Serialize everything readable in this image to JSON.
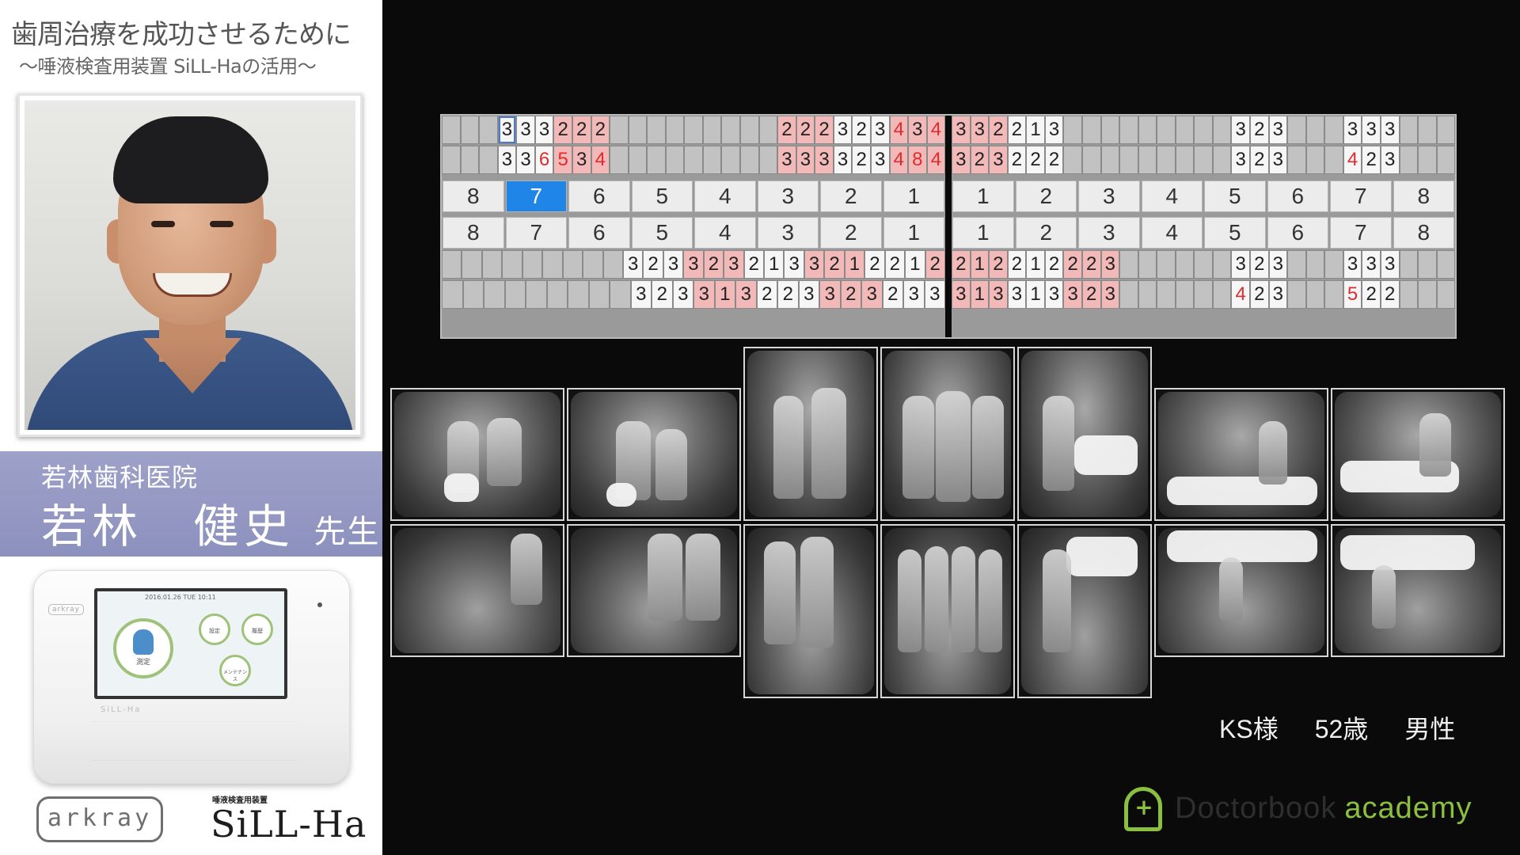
{
  "lecture": {
    "title": "歯周治療を成功させるために",
    "subtitle": "〜唾液検査用装置 SiLL-Haの活用〜"
  },
  "presenter": {
    "clinic": "若林歯科医院",
    "name": "若林　健史",
    "title": "先生"
  },
  "device": {
    "brand_mark": "arkray",
    "screen_date": "2016.01.26 TUE 10:11",
    "measure_label": "測定",
    "settings_label": "設定",
    "history_label": "履歴",
    "maintenance_label": "メンテナンス",
    "model_text": "SiLL-Ha"
  },
  "logos": {
    "arkray": "arkray",
    "sillha_caption": "唾液検査用装置",
    "sillha": "SiLL-Ha"
  },
  "perio_chart": {
    "right_jaw": {
      "upper_rows": [
        [
          "",
          "",
          "",
          "3",
          "3",
          "3",
          "2",
          "2",
          "2",
          "",
          "",
          "",
          "",
          "",
          "",
          "",
          "",
          "",
          "2",
          "2",
          "2",
          "3",
          "2",
          "3",
          "4",
          "3",
          "4"
        ],
        [
          "",
          "",
          "",
          "3",
          "3",
          "6",
          "5",
          "3",
          "4",
          "",
          "",
          "",
          "",
          "",
          "",
          "",
          "",
          "",
          "3",
          "3",
          "3",
          "3",
          "2",
          "3",
          "4",
          "8",
          "4"
        ]
      ],
      "teeth_upper": [
        "8",
        "7",
        "6",
        "5",
        "4",
        "3",
        "2",
        "1"
      ],
      "teeth_lower": [
        "8",
        "7",
        "6",
        "5",
        "4",
        "3",
        "2",
        "1"
      ],
      "lower_rows": [
        [
          "",
          "",
          "",
          "",
          "",
          "",
          "",
          "",
          "",
          "3",
          "2",
          "3",
          "3",
          "2",
          "3",
          "2",
          "1",
          "3",
          "3",
          "2",
          "1",
          "2",
          "2",
          "1",
          "2"
        ],
        [
          "",
          "",
          "",
          "",
          "",
          "",
          "",
          "",
          "",
          "3",
          "2",
          "3",
          "3",
          "1",
          "3",
          "2",
          "2",
          "3",
          "3",
          "2",
          "3",
          "2",
          "3",
          "3"
        ]
      ]
    },
    "left_jaw": {
      "upper_rows": [
        [
          "3",
          "3",
          "2",
          "2",
          "1",
          "3",
          "",
          "",
          "",
          "",
          "",
          "",
          "",
          "",
          "",
          "3",
          "2",
          "3",
          "",
          "",
          "",
          "3",
          "3",
          "3",
          "",
          "",
          ""
        ],
        [
          "3",
          "2",
          "3",
          "2",
          "2",
          "2",
          "",
          "",
          "",
          "",
          "",
          "",
          "",
          "",
          "",
          "3",
          "2",
          "3",
          "",
          "",
          "",
          "4",
          "2",
          "3",
          "",
          "",
          ""
        ]
      ],
      "teeth_upper": [
        "1",
        "2",
        "3",
        "4",
        "5",
        "6",
        "7",
        "8"
      ],
      "teeth_lower": [
        "1",
        "2",
        "3",
        "4",
        "5",
        "6",
        "7",
        "8"
      ],
      "lower_rows": [
        [
          "2",
          "1",
          "2",
          "2",
          "1",
          "2",
          "2",
          "2",
          "3",
          "",
          "",
          "",
          "",
          "",
          "",
          "3",
          "2",
          "3",
          "",
          "",
          "",
          "3",
          "3",
          "3",
          "",
          "",
          ""
        ],
        [
          "3",
          "1",
          "3",
          "3",
          "1",
          "3",
          "3",
          "2",
          "3",
          "",
          "",
          "",
          "",
          "",
          "",
          "4",
          "2",
          "3",
          "",
          "",
          "",
          "5",
          "2",
          "2",
          "",
          "",
          ""
        ]
      ]
    },
    "colors": {
      "pink": "#f3b8b8",
      "red_text": "#e02c2c",
      "selected_tooth": "#1f86e8"
    }
  },
  "xrays": {
    "upper": [
      "upper-right-molar",
      "upper-right-premolar",
      "upper-right-canine",
      "upper-anterior",
      "upper-left-canine",
      "upper-left-premolar",
      "upper-left-molar"
    ],
    "lower": [
      "lower-right-molar",
      "lower-right-premolar",
      "lower-right-canine",
      "lower-anterior",
      "lower-left-canine",
      "lower-left-premolar",
      "lower-left-molar"
    ]
  },
  "patient": {
    "id": "KS様",
    "age": "52歳",
    "sex": "男性"
  },
  "brand": {
    "name_dark": "Doctorbook",
    "name_green": "academy",
    "accent": "#8bbf3f"
  }
}
